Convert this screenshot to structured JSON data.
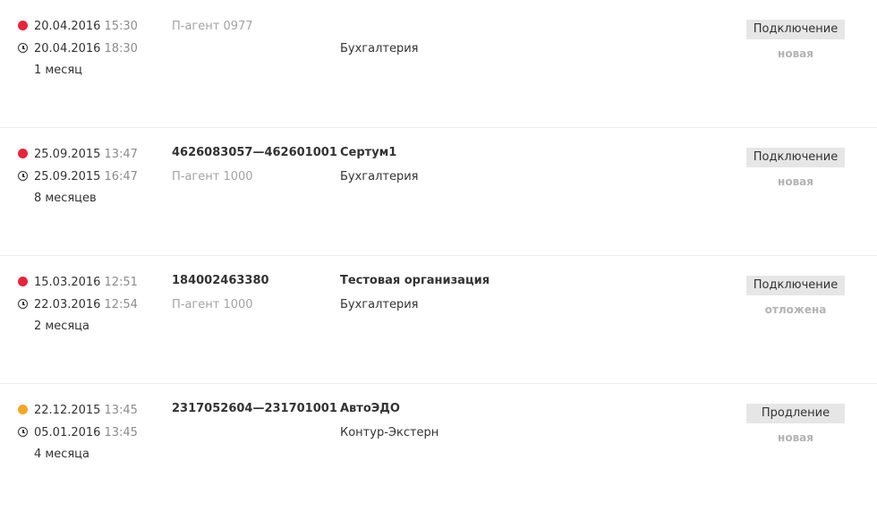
{
  "colors": {
    "overdue_dot": "#e8243a",
    "warning_dot": "#f5a623",
    "button_bg": "#e6e6e6",
    "muted_text": "#a3a3a3"
  },
  "icons": {
    "status_dot": "circle-dot-icon",
    "deadline": "clock-icon"
  },
  "requests": [
    {
      "status_color": "red",
      "created_date": "20.04.2016",
      "created_time": "15:30",
      "deadline_date": "20.04.2016",
      "deadline_time": "18:30",
      "duration": "1 месяц",
      "inn": "",
      "agent": "П-агент 0977",
      "organization": "",
      "product": "Бухгалтерия",
      "type_label": "Подключение",
      "status_label": "новая"
    },
    {
      "status_color": "red",
      "created_date": "25.09.2015",
      "created_time": "13:47",
      "deadline_date": "25.09.2015",
      "deadline_time": "16:47",
      "duration": "8 месяцев",
      "inn": "4626083057—462601001",
      "agent": "П-агент 1000",
      "organization": "Сертум1",
      "product": "Бухгалтерия",
      "type_label": "Подключение",
      "status_label": "новая"
    },
    {
      "status_color": "red",
      "created_date": "15.03.2016",
      "created_time": "12:51",
      "deadline_date": "22.03.2016",
      "deadline_time": "12:54",
      "duration": "2 месяца",
      "inn": "184002463380",
      "agent": "П-агент 1000",
      "organization": "Тестовая организация",
      "product": "Бухгалтерия",
      "type_label": "Подключение",
      "status_label": "отложена"
    },
    {
      "status_color": "orange",
      "created_date": "22.12.2015",
      "created_time": "13:45",
      "deadline_date": "05.01.2016",
      "deadline_time": "13:45",
      "duration": "4 месяца",
      "inn": "2317052604—231701001",
      "agent": "",
      "organization": "АвтоЭДО",
      "product": "Контур-Экстерн",
      "type_label": "Продление",
      "status_label": "новая"
    }
  ]
}
